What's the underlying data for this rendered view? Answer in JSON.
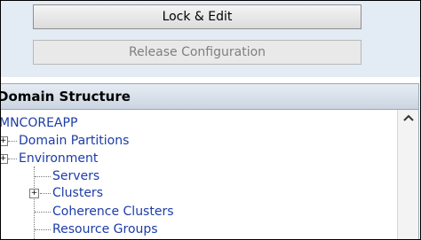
{
  "change_center": {
    "lock_edit_label": "Lock & Edit",
    "release_config_label": "Release Configuration"
  },
  "domain_structure": {
    "title": "Domain Structure",
    "root": "MNCOREAPP",
    "items": [
      {
        "label": "Domain Partitions"
      },
      {
        "label": "Environment"
      },
      {
        "label": "Servers"
      },
      {
        "label": "Clusters"
      },
      {
        "label": "Coherence Clusters"
      },
      {
        "label": "Resource Groups"
      }
    ],
    "expander_symbol": "+"
  },
  "icons": {
    "scroll_up": "scroll-up-icon",
    "expand": "expand-icon"
  }
}
